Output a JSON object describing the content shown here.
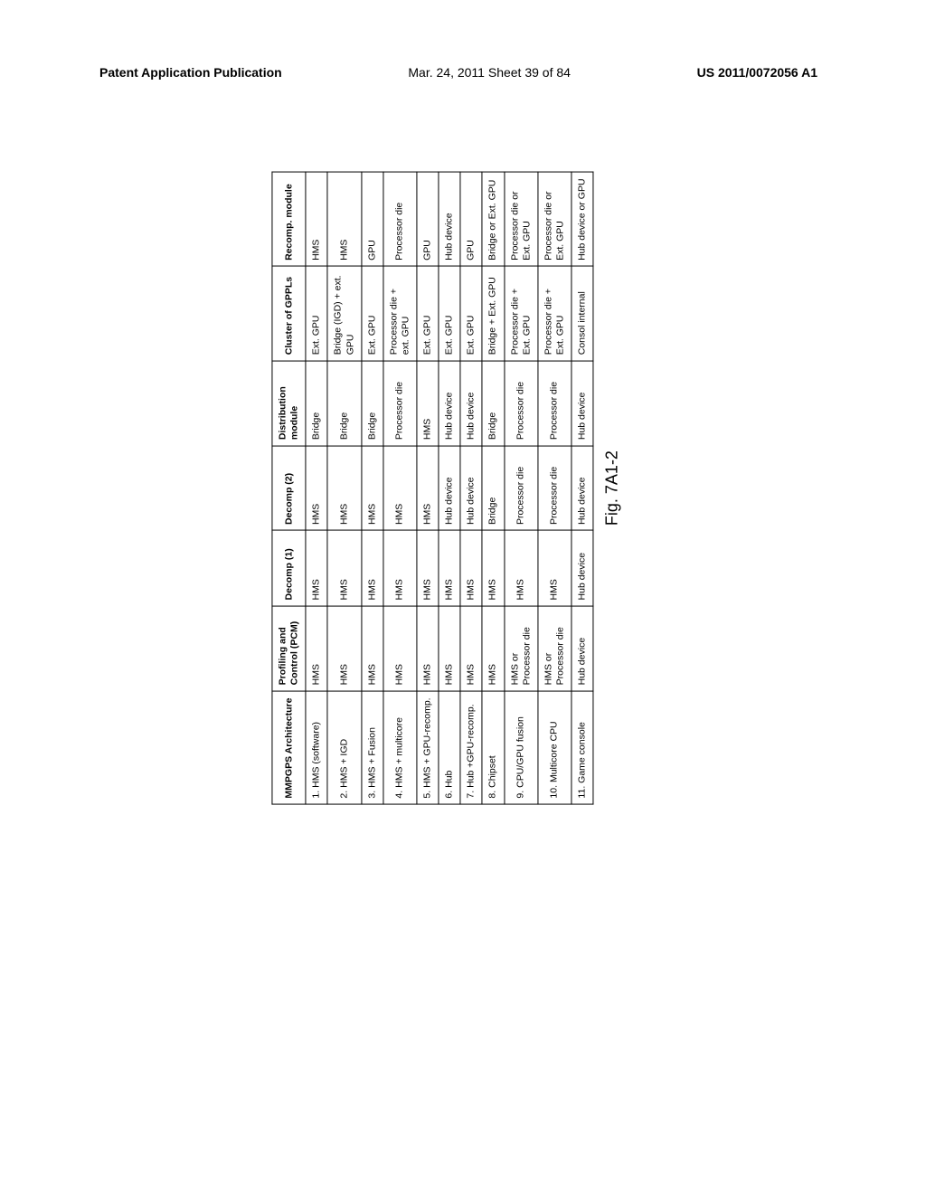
{
  "header": {
    "left": "Patent Application Publication",
    "center": "Mar. 24, 2011  Sheet 39 of 84",
    "right": "US 2011/0072056 A1"
  },
  "table": {
    "headers": {
      "arch": "MMPGPS Architecture",
      "pcm": "Profiling and Control (PCM)",
      "d1": "Decomp (1)",
      "d2": "Decomp (2)",
      "dist": "Distribution module",
      "gppl": "Cluster of GPPLs",
      "rec": "Recomp. module"
    },
    "rows": [
      {
        "arch": "1. HMS (software)",
        "pcm": "HMS",
        "d1": "HMS",
        "d2": "HMS",
        "dist": "Bridge",
        "gppl": "Ext. GPU",
        "rec": "HMS"
      },
      {
        "arch": "2. HMS + IGD",
        "pcm": "HMS",
        "d1": "HMS",
        "d2": "HMS",
        "dist": "Bridge",
        "gppl": "Bridge (IGD) + ext. GPU",
        "rec": "HMS"
      },
      {
        "arch": "3. HMS + Fusion",
        "pcm": "HMS",
        "d1": "HMS",
        "d2": "HMS",
        "dist": "Bridge",
        "gppl": "Ext. GPU",
        "rec": "GPU"
      },
      {
        "arch": "4. HMS + multicore",
        "pcm": "HMS",
        "d1": "HMS",
        "d2": "HMS",
        "dist": "Processor die",
        "gppl": "Processor die + ext. GPU",
        "rec": "Processor die"
      },
      {
        "arch": "5. HMS + GPU-recomp.",
        "pcm": "HMS",
        "d1": "HMS",
        "d2": "HMS",
        "dist": "HMS",
        "gppl": "Ext. GPU",
        "rec": "GPU"
      },
      {
        "arch": "6. Hub",
        "pcm": "HMS",
        "d1": "HMS",
        "d2": "Hub device",
        "dist": "Hub device",
        "gppl": "Ext. GPU",
        "rec": "Hub device"
      },
      {
        "arch": "7. Hub +GPU-recomp.",
        "pcm": "HMS",
        "d1": "HMS",
        "d2": "Hub device",
        "dist": "Hub device",
        "gppl": "Ext. GPU",
        "rec": "GPU"
      },
      {
        "arch": "8. Chipset",
        "pcm": "HMS",
        "d1": "HMS",
        "d2": "Bridge",
        "dist": "Bridge",
        "gppl": "Bridge + Ext. GPU",
        "rec": "Bridge or Ext. GPU"
      },
      {
        "arch": "9. CPU/GPU fusion",
        "pcm": "HMS or Processor die",
        "d1": "HMS",
        "d2": "Processor die",
        "dist": "Processor die",
        "gppl": "Processor die + Ext. GPU",
        "rec": "Processor die or Ext. GPU"
      },
      {
        "arch": "10. Multicore CPU",
        "pcm": "HMS or Processor die",
        "d1": "HMS",
        "d2": "Processor die",
        "dist": "Processor die",
        "gppl": "Processor die + Ext. GPU",
        "rec": "Processor die or Ext. GPU"
      },
      {
        "arch": "11. Game console",
        "pcm": "Hub device",
        "d1": "Hub device",
        "d2": "Hub device",
        "dist": "Hub device",
        "gppl": "Consol internal",
        "rec": "Hub device or GPU"
      }
    ]
  },
  "figure_label": "Fig. 7A1-2"
}
